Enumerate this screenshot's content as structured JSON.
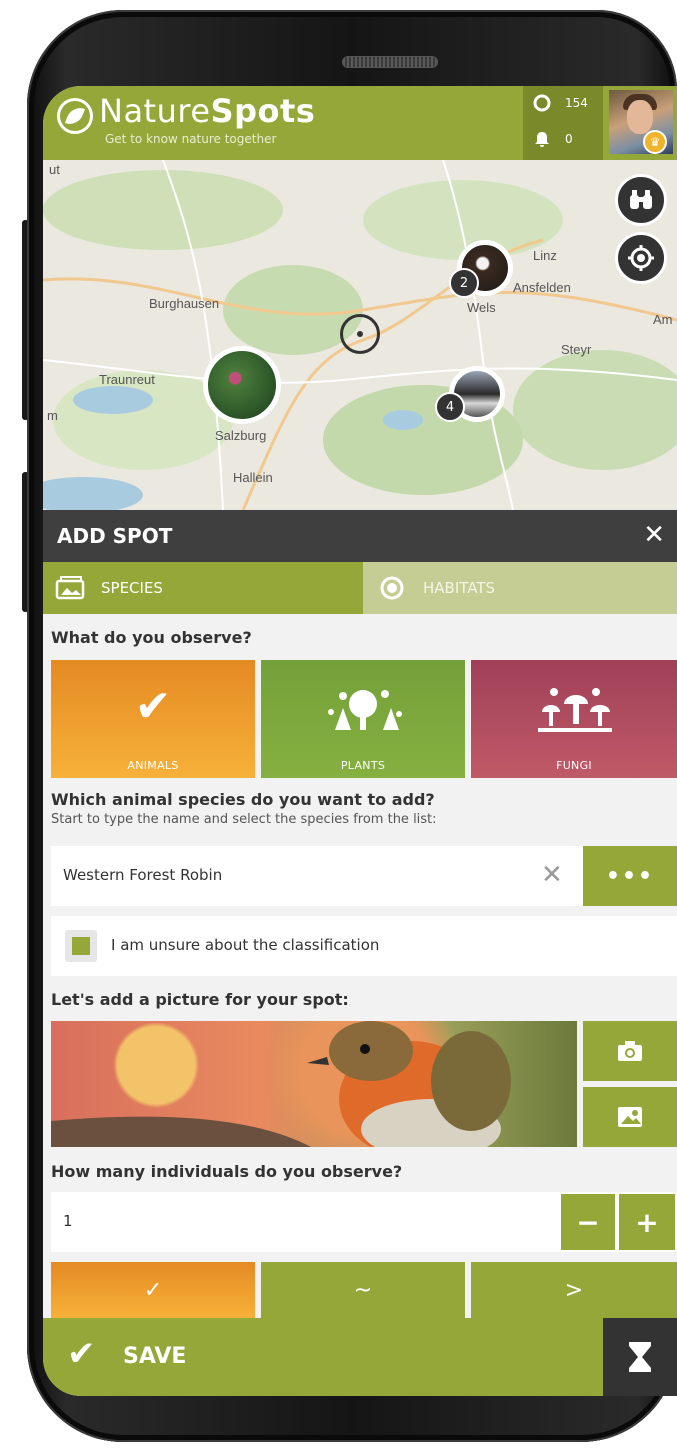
{
  "app": {
    "brand_light": "Nature",
    "brand_bold": "Spots",
    "tagline": "Get to know nature together",
    "points": "154",
    "notifications": "0"
  },
  "map": {
    "labels": [
      "ut",
      "Burghausen",
      "Traunreut",
      "Salzburg",
      "Hallein",
      "Linz",
      "Ansfelden",
      "Wels",
      "Steyr",
      "Am",
      "m"
    ],
    "cluster_counts": [
      "2",
      "4"
    ]
  },
  "panel": {
    "title": "ADD SPOT",
    "tabs": [
      "SPECIES",
      "HABITATS"
    ],
    "observe_question": "What do you observe?",
    "categories": [
      "ANIMALS",
      "PLANTS",
      "FUNGI"
    ],
    "species_question": "Which animal species do you want to add?",
    "species_hint": "Start to type the name and select the species from the list:",
    "species_value": "Western Forest Robin",
    "unsure_label": "I am unsure about the classification",
    "picture_question": "Let's add a picture for your spot:",
    "count_question": "How many individuals do you observe?",
    "count_value": "1",
    "count_modes": [
      "✓",
      "~",
      ">"
    ],
    "save_label": "SAVE"
  },
  "colors": {
    "accent": "#96a73a",
    "accent_dark": "#7a8a2a",
    "animals": "#f0a530",
    "plants": "#7fa53a",
    "fungi": "#b04a5a",
    "dark": "#3f3f3f"
  },
  "icons": [
    "phone-logo-icon",
    "nature-logo-icon",
    "spot-icon",
    "bell-icon",
    "binoculars-icon",
    "locate-icon",
    "crosshair-icon",
    "close-icon",
    "photo-icon",
    "target-icon",
    "check-icon",
    "plants-icon",
    "fungi-icon",
    "clear-icon",
    "more-icon",
    "camera-icon",
    "image-icon",
    "minus-icon",
    "plus-icon",
    "hourglass-icon"
  ]
}
